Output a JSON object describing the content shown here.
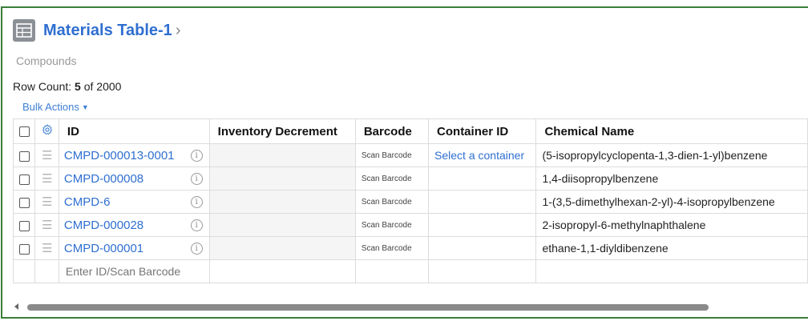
{
  "header": {
    "title": "Materials Table-1",
    "chevron": "›",
    "subtitle": "Compounds"
  },
  "row_count": {
    "label": "Row Count: ",
    "count": "5",
    "suffix": " of 2000"
  },
  "bulk_actions": "Bulk Actions",
  "columns": {
    "id": "ID",
    "inventory": "Inventory Decrement",
    "barcode": "Barcode",
    "container": "Container ID",
    "chemical": "Chemical Name"
  },
  "rows": [
    {
      "id": "CMPD-000013-0001",
      "barcode": "Scan Barcode",
      "container": "Select a container",
      "chemical": "(5-isopropylcyclopenta-1,3-dien-1-yl)benzene"
    },
    {
      "id": "CMPD-000008",
      "barcode": "Scan Barcode",
      "container": "",
      "chemical": "1,4-diisopropylbenzene"
    },
    {
      "id": "CMPD-6",
      "barcode": "Scan Barcode",
      "container": "",
      "chemical": "1-(3,5-dimethylhexan-2-yl)-4-isopropylbenzene"
    },
    {
      "id": "CMPD-000028",
      "barcode": "Scan Barcode",
      "container": "",
      "chemical": "2-isopropyl-6-methylnaphthalene"
    },
    {
      "id": "CMPD-000001",
      "barcode": "Scan Barcode",
      "container": "",
      "chemical": "ethane-1,1-diyldibenzene"
    }
  ],
  "entry_placeholder": "Enter ID/Scan Barcode",
  "info_glyph": "i"
}
